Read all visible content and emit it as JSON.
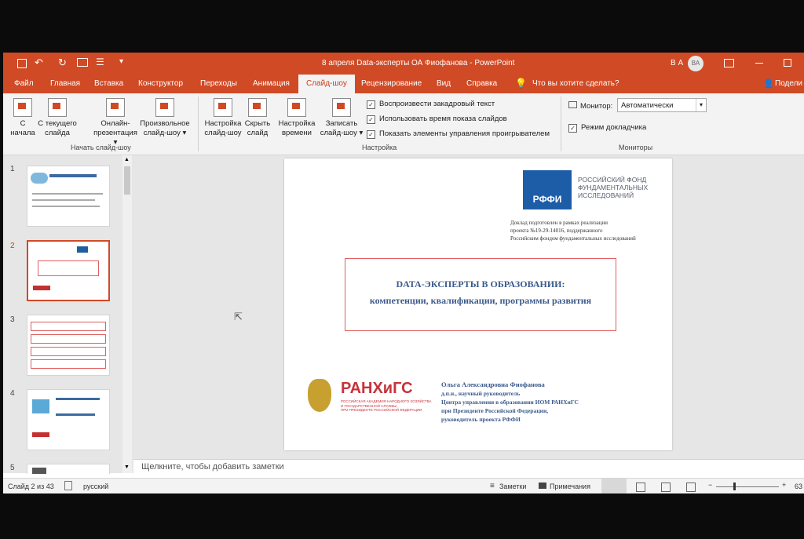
{
  "window": {
    "title": "8 апреля Data-эксперты ОА Фиофанова  -  PowerPoint",
    "user_initials": "В А",
    "avatar_initials": "ВА"
  },
  "tabs": [
    "Файл",
    "Главная",
    "Вставка",
    "Конструктор",
    "Переходы",
    "Анимация",
    "Слайд-шоу",
    "Рецензирование",
    "Вид",
    "Справка"
  ],
  "tell_me": "Что вы хотите сделать?",
  "share": "Подели",
  "ribbon": {
    "start": {
      "from_start_1": "С",
      "from_start_2": "начала",
      "from_current_1": "С текущего",
      "from_current_2": "слайда",
      "online_1": "Онлайн-",
      "online_2": "презентация",
      "custom_1": "Произвольное",
      "custom_2": "слайд-шоу",
      "group": "Начать слайд-шоу"
    },
    "setup": {
      "setup_1": "Настройка",
      "setup_2": "слайд-шоу",
      "hide_1": "Скрыть",
      "hide_2": "слайд",
      "timing_1": "Настройка",
      "timing_2": "времени",
      "record_1": "Записать",
      "record_2": "слайд-шоу",
      "chk_narration": "Воспроизвести закадровый текст",
      "chk_timings": "Использовать время показа слайдов",
      "chk_controls": "Показать элементы управления проигрывателем",
      "group": "Настройка"
    },
    "monitors": {
      "monitor_label": "Монитор:",
      "monitor_value": "Автоматически",
      "presenter": "Режим докладчика",
      "group": "Мониторы"
    }
  },
  "thumbnails": [
    "1",
    "2",
    "3",
    "4",
    "5"
  ],
  "slide": {
    "rffi_logo": "РФФИ",
    "rffi_name_1": "РОССИЙСКИЙ ФОНД",
    "rffi_name_2": "ФУНДАМЕНТАЛЬНЫХ",
    "rffi_name_3": "ИССЛЕДОВАНИЙ",
    "grant_1": "Доклад подготовлен в рамках реализации",
    "grant_2": "проекта №19-29-14016, поддержанного",
    "grant_3": "Российским фондом фундаментальных исследований",
    "title_1": "DATA-ЭКСПЕРТЫ  В ОБРАЗОВАНИИ:",
    "title_2": "компетенции, квалификации, программы развития",
    "ranepa_logo": "РАНХиГС",
    "ranepa_sub_1": "РОССИЙСКАЯ АКАДЕМИЯ НАРОДНОГО ХОЗЯЙСТВА",
    "ranepa_sub_2": "И ГОСУДАРСТВЕННОЙ СЛУЖБЫ",
    "ranepa_sub_3": "ПРИ ПРЕЗИДЕНТЕ РОССИЙСКОЙ ФЕДЕРАЦИИ",
    "author_1": "Ольга Александровна Фиофанова",
    "author_2": "д.п.н., научный руководитель",
    "author_3": "Центра управления в образовании ИОМ РАНХиГС",
    "author_4": "при Президенте Российской Федерации,",
    "author_5": "руководитель проекта РФФИ"
  },
  "notes_placeholder": "Щелкните, чтобы добавить заметки",
  "status": {
    "slide": "Слайд 2 из 43",
    "language": "русский",
    "notes": "Заметки",
    "comments": "Примечания",
    "zoom": "63"
  },
  "colors": {
    "accent": "#d04a25",
    "slide_title": "#3b5a8c",
    "slide_frame": "#e06060"
  }
}
